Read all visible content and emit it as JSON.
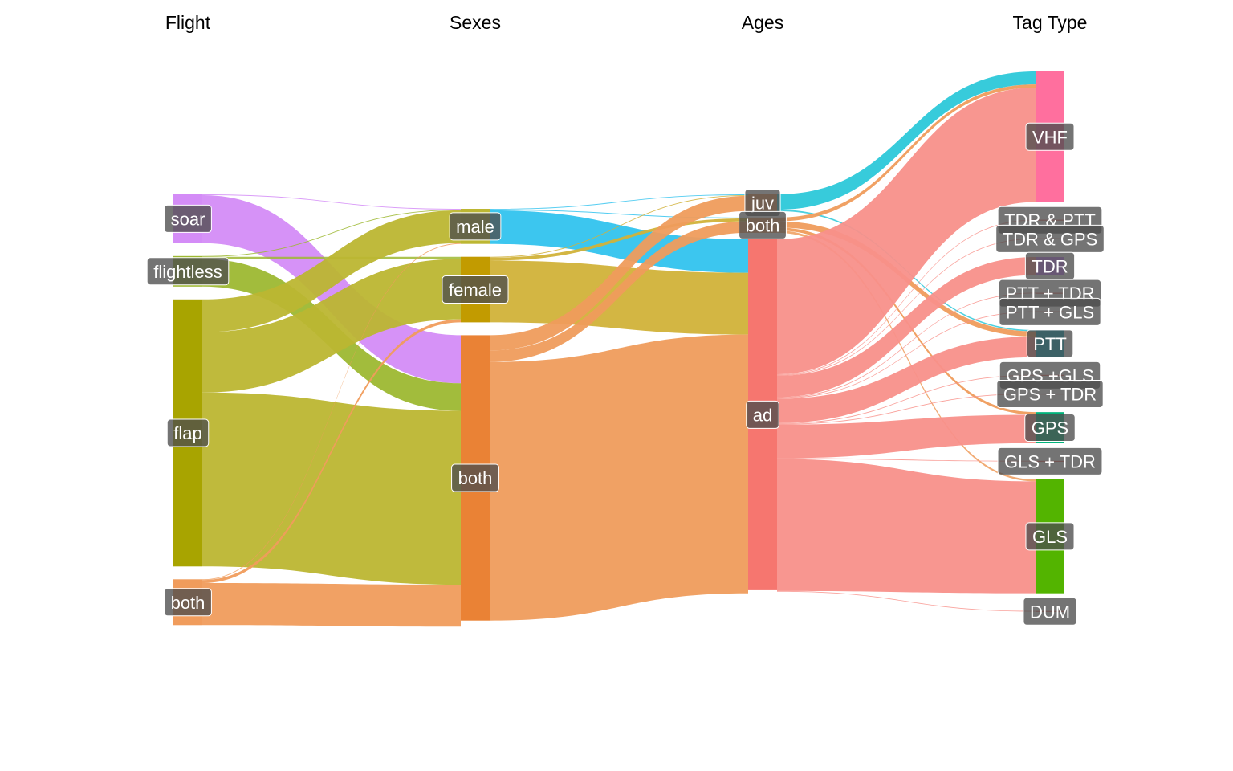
{
  "axes": [
    {
      "id": "flight",
      "title": "Flight"
    },
    {
      "id": "sexes",
      "title": "Sexes"
    },
    {
      "id": "ages",
      "title": "Ages"
    },
    {
      "id": "tag",
      "title": "Tag Type"
    }
  ],
  "nodes": {
    "flight": [
      {
        "id": "soar",
        "label": "soar",
        "value": 3.2,
        "color": "#D48CF7"
      },
      {
        "id": "flightless",
        "label": "flightless",
        "value": 2.0,
        "color": "#9DB832"
      },
      {
        "id": "flap",
        "label": "flap",
        "value": 17.5,
        "color": "#A8A400"
      },
      {
        "id": "both",
        "label": "both",
        "value": 3.0,
        "color": "#F09C5C"
      }
    ],
    "sexes": [
      {
        "id": "male",
        "label": "male",
        "value": 2.3,
        "color": "#BCB632"
      },
      {
        "id": "female",
        "label": "female",
        "value": 4.3,
        "color": "#C29B00"
      },
      {
        "id": "both",
        "label": "both",
        "value": 18.7,
        "color": "#EA8235"
      }
    ],
    "ages": [
      {
        "id": "juv",
        "label": "juv",
        "value": 1.1,
        "color": "#EF9C5C"
      },
      {
        "id": "both",
        "label": "both",
        "value": 1.0,
        "color": "#EF9C5C"
      },
      {
        "id": "ad",
        "label": "ad",
        "value": 23.0,
        "color": "#F6766F"
      }
    ],
    "tag": [
      {
        "id": "vhf",
        "label": "VHF",
        "value": 10.1,
        "color": "#FF6F9E"
      },
      {
        "id": "tdr_ptt",
        "label": "TDR & PTT",
        "value": 0.05,
        "color": "#F6766F"
      },
      {
        "id": "tdr_gps",
        "label": "TDR & GPS",
        "value": 0.05,
        "color": "#F6766F"
      },
      {
        "id": "tdr",
        "label": "TDR",
        "value": 1.4,
        "color": "#C77CFF"
      },
      {
        "id": "ptt_tdr",
        "label": "PTT + TDR",
        "value": 0.05,
        "color": "#F6766F"
      },
      {
        "id": "ptt_gls",
        "label": "PTT + GLS",
        "value": 0.05,
        "color": "#F6766F"
      },
      {
        "id": "ptt",
        "label": "PTT",
        "value": 2.1,
        "color": "#00A9C0"
      },
      {
        "id": "gps_gls",
        "label": "GPS +GLS",
        "value": 0.05,
        "color": "#F6766F"
      },
      {
        "id": "gps_tdr",
        "label": "GPS + TDR",
        "value": 0.05,
        "color": "#F6766F"
      },
      {
        "id": "gps",
        "label": "GPS",
        "value": 2.4,
        "color": "#00B47B"
      },
      {
        "id": "gls_tdr",
        "label": "GLS + TDR",
        "value": 0.05,
        "color": "#F6766F"
      },
      {
        "id": "gls",
        "label": "GLS",
        "value": 8.8,
        "color": "#53B400"
      },
      {
        "id": "dum",
        "label": "DUM",
        "value": 0.05,
        "color": "#F6766F"
      }
    ]
  },
  "links": [
    {
      "stage": 0,
      "source": "soar",
      "target": "male",
      "value": 0.05,
      "color": "#D48CF7"
    },
    {
      "stage": 0,
      "source": "soar",
      "target": "both",
      "value": 3.15,
      "color": "#D48CF7"
    },
    {
      "stage": 0,
      "source": "flightless",
      "target": "male",
      "value": 0.05,
      "color": "#9DB832"
    },
    {
      "stage": 0,
      "source": "flightless",
      "target": "female",
      "value": 0.15,
      "color": "#9DB832"
    },
    {
      "stage": 0,
      "source": "flightless",
      "target": "both",
      "value": 1.8,
      "color": "#9DB832"
    },
    {
      "stage": 0,
      "source": "flap",
      "target": "male",
      "value": 2.15,
      "color": "#BCB632"
    },
    {
      "stage": 0,
      "source": "flap",
      "target": "female",
      "value": 3.95,
      "color": "#BCB632"
    },
    {
      "stage": 0,
      "source": "flap",
      "target": "both",
      "value": 11.4,
      "color": "#BCB632"
    },
    {
      "stage": 0,
      "source": "both",
      "target": "male",
      "value": 0.05,
      "color": "#F09C5C"
    },
    {
      "stage": 0,
      "source": "both",
      "target": "female",
      "value": 0.2,
      "color": "#F09C5C"
    },
    {
      "stage": 0,
      "source": "both",
      "target": "both",
      "value": 2.75,
      "color": "#F09C5C"
    },
    {
      "stage": 1,
      "source": "male",
      "target": "juv",
      "value": 0.05,
      "color": "#32C3EE"
    },
    {
      "stage": 1,
      "source": "male",
      "target": "both",
      "value": 0.05,
      "color": "#32C3EE"
    },
    {
      "stage": 1,
      "source": "male",
      "target": "ad",
      "value": 2.2,
      "color": "#32C3EE"
    },
    {
      "stage": 1,
      "source": "female",
      "target": "juv",
      "value": 0.05,
      "color": "#D1B239"
    },
    {
      "stage": 1,
      "source": "female",
      "target": "both",
      "value": 0.2,
      "color": "#D1B239"
    },
    {
      "stage": 1,
      "source": "female",
      "target": "ad",
      "value": 4.05,
      "color": "#D1B239"
    },
    {
      "stage": 1,
      "source": "both",
      "target": "juv",
      "value": 1.0,
      "color": "#EF9C5C"
    },
    {
      "stage": 1,
      "source": "both",
      "target": "both",
      "value": 0.75,
      "color": "#EF9C5C"
    },
    {
      "stage": 1,
      "source": "both",
      "target": "ad",
      "value": 16.95,
      "color": "#EF9C5C"
    },
    {
      "stage": 2,
      "source": "juv",
      "target": "vhf",
      "value": 1.0,
      "color": "#2CC8D9"
    },
    {
      "stage": 2,
      "source": "juv",
      "target": "ptt",
      "value": 0.1,
      "color": "#2CC8D9"
    },
    {
      "stage": 2,
      "source": "both",
      "target": "vhf",
      "value": 0.25,
      "color": "#EF9C5C"
    },
    {
      "stage": 2,
      "source": "both",
      "target": "ptt",
      "value": 0.4,
      "color": "#EF9C5C"
    },
    {
      "stage": 2,
      "source": "both",
      "target": "gps",
      "value": 0.2,
      "color": "#EF9C5C"
    },
    {
      "stage": 2,
      "source": "both",
      "target": "gls",
      "value": 0.15,
      "color": "#EF9C5C"
    },
    {
      "stage": 2,
      "source": "ad",
      "target": "vhf",
      "value": 8.85,
      "color": "#F8908A"
    },
    {
      "stage": 2,
      "source": "ad",
      "target": "tdr_ptt",
      "value": 0.05,
      "color": "#F8908A"
    },
    {
      "stage": 2,
      "source": "ad",
      "target": "tdr_gps",
      "value": 0.05,
      "color": "#F8908A"
    },
    {
      "stage": 2,
      "source": "ad",
      "target": "tdr",
      "value": 1.4,
      "color": "#F8908A"
    },
    {
      "stage": 2,
      "source": "ad",
      "target": "ptt_tdr",
      "value": 0.05,
      "color": "#F8908A"
    },
    {
      "stage": 2,
      "source": "ad",
      "target": "ptt_gls",
      "value": 0.05,
      "color": "#F8908A"
    },
    {
      "stage": 2,
      "source": "ad",
      "target": "ptt",
      "value": 1.6,
      "color": "#F8908A"
    },
    {
      "stage": 2,
      "source": "ad",
      "target": "gps_gls",
      "value": 0.05,
      "color": "#F8908A"
    },
    {
      "stage": 2,
      "source": "ad",
      "target": "gps_tdr",
      "value": 0.05,
      "color": "#F8908A"
    },
    {
      "stage": 2,
      "source": "ad",
      "target": "gps",
      "value": 2.2,
      "color": "#F8908A"
    },
    {
      "stage": 2,
      "source": "ad",
      "target": "gls_tdr",
      "value": 0.05,
      "color": "#F8908A"
    },
    {
      "stage": 2,
      "source": "ad",
      "target": "gls",
      "value": 8.65,
      "color": "#F8908A"
    },
    {
      "stage": 2,
      "source": "ad",
      "target": "dum",
      "value": 0.05,
      "color": "#F8908A"
    }
  ]
}
